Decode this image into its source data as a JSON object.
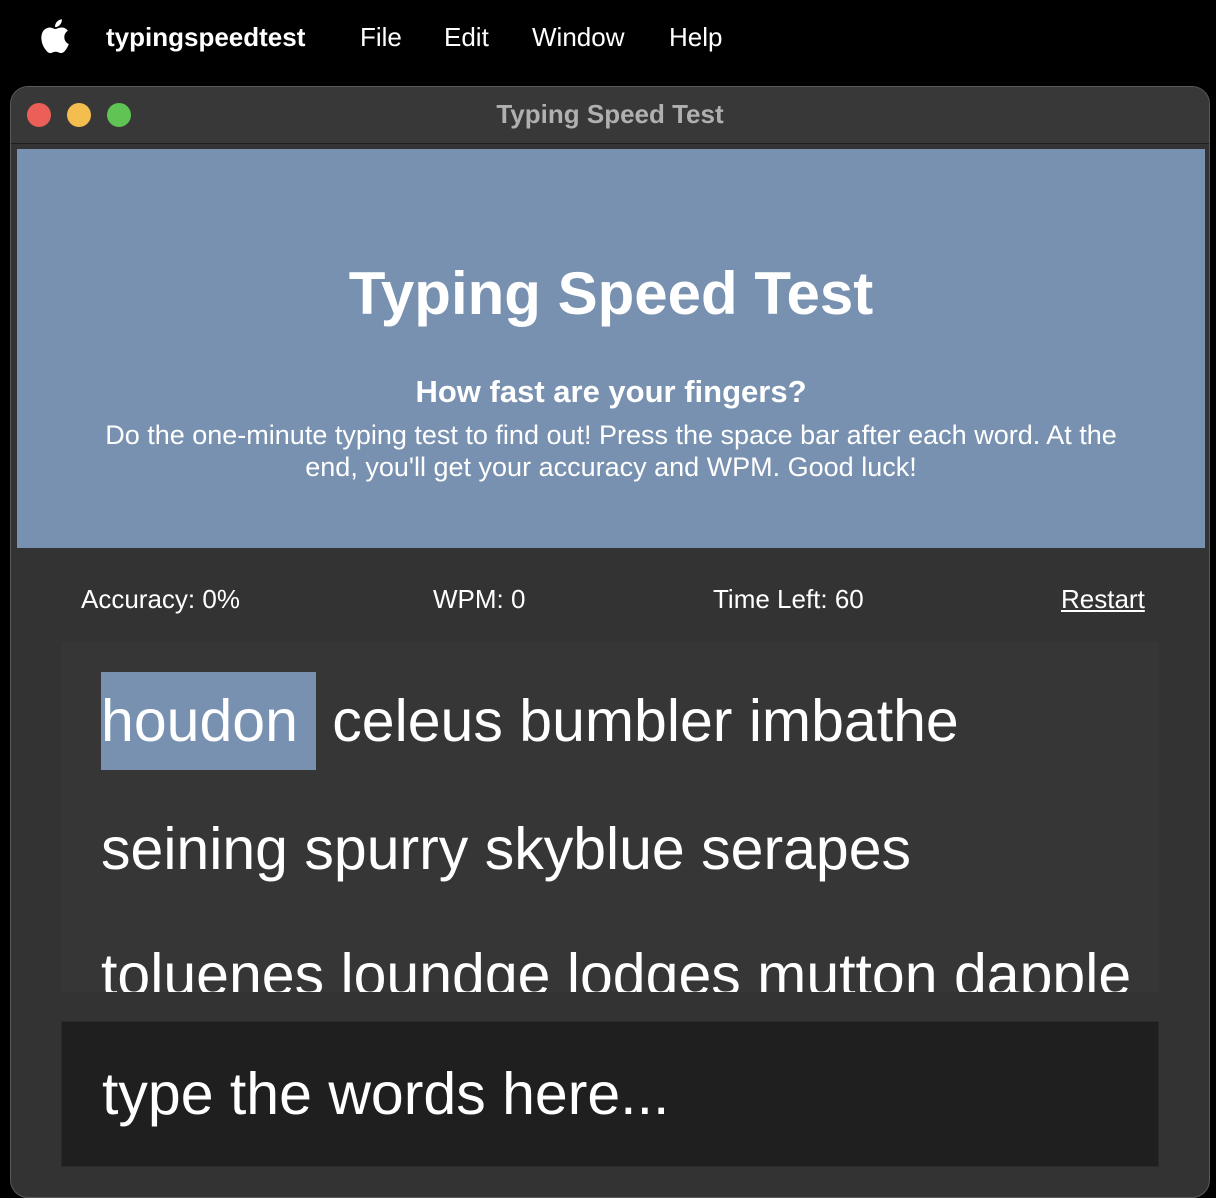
{
  "menubar": {
    "app_name": "typingspeedtest",
    "items": [
      "File",
      "Edit",
      "Window",
      "Help"
    ]
  },
  "window": {
    "title": "Typing Speed Test"
  },
  "hero": {
    "title": "Typing Speed Test",
    "subtitle": "How fast are your fingers?",
    "description": "Do the one-minute typing test to find out! Press the space bar after each word. At the end, you'll get your accuracy and WPM. Good luck!"
  },
  "stats": {
    "accuracy": "Accuracy: 0%",
    "wpm": "WPM: 0",
    "time_left": "Time Left: 60",
    "restart_label": "Restart"
  },
  "words": {
    "lines": [
      [
        "houdon",
        "celeus",
        "bumbler",
        "imbathe"
      ],
      [
        "seining",
        "spurry",
        "skyblue",
        "serapes"
      ],
      [
        "toluenes",
        "loundge",
        "lodges",
        "mutton",
        "dapple"
      ]
    ],
    "current_index": 0
  },
  "input": {
    "placeholder": "type the words here...",
    "value": ""
  },
  "colors": {
    "accent": "#7891b0",
    "window_bg": "#333333",
    "input_bg": "#1f1f1f",
    "close": "#ec5f58",
    "minimize": "#f4bd4f",
    "maximize": "#5fc454"
  }
}
